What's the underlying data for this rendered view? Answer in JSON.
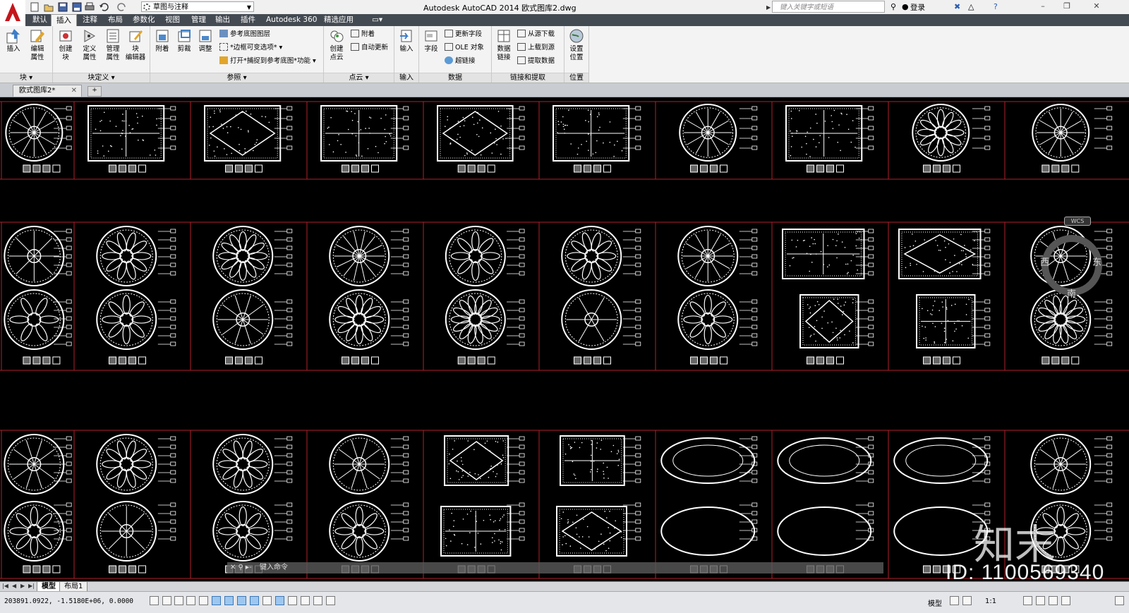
{
  "app": {
    "title": "Autodesk AutoCAD 2014    欧式图库2.dwg",
    "workspace": "草图与注释",
    "search_placeholder": "键入关键字或短语",
    "login": "登录"
  },
  "ribbon": {
    "tabs": [
      "默认",
      "插入",
      "注释",
      "布局",
      "参数化",
      "视图",
      "管理",
      "输出",
      "插件",
      "Autodesk 360",
      "精选应用"
    ],
    "active_tab": "插入",
    "panels": {
      "block": {
        "title": "块",
        "insert": "插入",
        "edit_attr": "编辑\n属性"
      },
      "block_def": {
        "title": "块定义",
        "create": "创建\n块",
        "define_attr": "定义\n属性",
        "manage_attr": "管理\n属性",
        "block_editor": "块\n编辑器"
      },
      "reference": {
        "title": "参照",
        "attach": "附着",
        "clip": "剪裁",
        "adjust": "调整",
        "underlay_layers": "参考底图图层",
        "frame_variable": "*边框可变选项*",
        "snap_underlay": "打开*捕捉到参考底图*功能"
      },
      "pointcloud": {
        "title": "点云",
        "create": "创建\n点云",
        "attach": "附着",
        "auto_update": "自动更新"
      },
      "import": {
        "title": "输入",
        "import": "输入"
      },
      "data": {
        "title": "数据",
        "field": "字段",
        "update_fields": "更新字段",
        "ole_object": "OLE 对象",
        "hyperlink": "超链接"
      },
      "linking": {
        "title": "链接和提取",
        "data_link": "数据\n链接",
        "download_source": "从源下载",
        "upload_source": "上载到源",
        "extract_data": "提取数据"
      },
      "location": {
        "title": "位置",
        "set_location": "设置\n位置"
      }
    }
  },
  "document_tab": {
    "name": "欧式图库2*"
  },
  "viewcube": {
    "west": "西",
    "east": "东",
    "south": "南",
    "wcs": "WCS"
  },
  "command_line": {
    "placeholder": "键入命令"
  },
  "layout_tabs": {
    "model": "模型",
    "layout1": "布局1"
  },
  "status_bar": {
    "coordinates": "203891.0922, -1.5180E+06, 0.0000",
    "model": "模型",
    "annotation_scale": "1:1"
  },
  "watermark": {
    "id": "ID: 1100569340",
    "logo": "知末"
  },
  "colors": {
    "accent_red": "#b2202a",
    "ribbon_dark": "#444a52",
    "canvas": "#000000"
  }
}
